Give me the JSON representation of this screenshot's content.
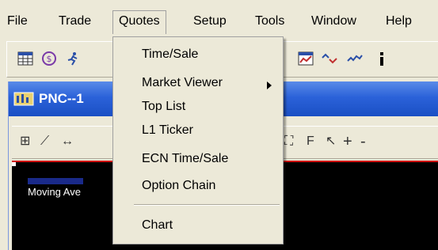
{
  "menubar": {
    "items": [
      {
        "label": "File"
      },
      {
        "label": "Trade"
      },
      {
        "label": "Quotes"
      },
      {
        "label": "Setup"
      },
      {
        "label": "Tools"
      },
      {
        "label": "Window"
      },
      {
        "label": "Help"
      }
    ]
  },
  "window": {
    "title": "PNC--1",
    "icon": "chart-window-icon",
    "chart_label": "Moving Ave",
    "chart_background": "#000000"
  },
  "quotes_menu": {
    "items": [
      {
        "label": "Time/Sale"
      },
      {
        "label": "Market Viewer",
        "submenu": true
      },
      {
        "label": "Top List"
      },
      {
        "label": "L1 Ticker"
      },
      {
        "label": "ECN Time/Sale"
      },
      {
        "label": "Option Chain"
      },
      {
        "label": "Chart"
      }
    ]
  },
  "chart_toolbar": {
    "buttons": [
      "F",
      "+",
      "-"
    ]
  },
  "colors": {
    "titlebar": "#2b62d9",
    "menu_bg": "#ece9d8"
  }
}
